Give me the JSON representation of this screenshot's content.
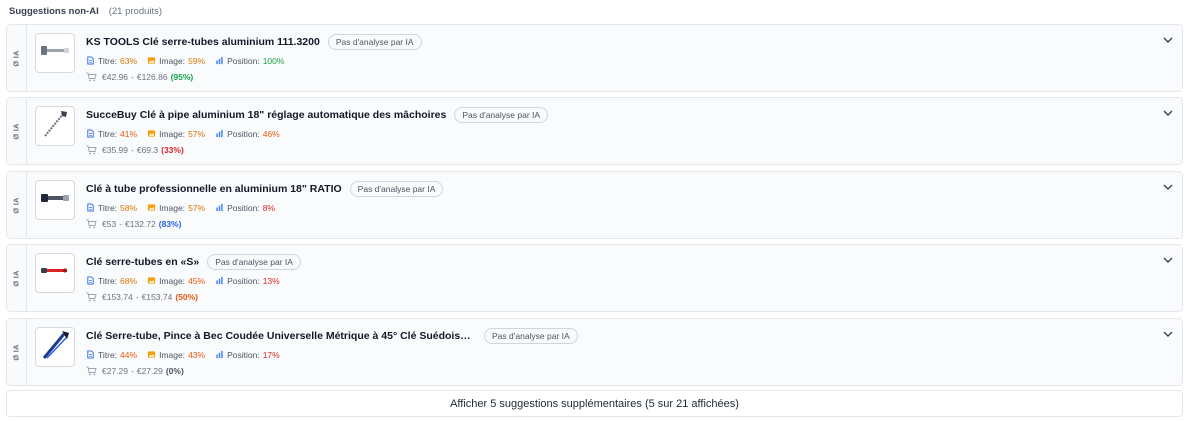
{
  "header": {
    "title": "Suggestions non-AI",
    "count": "(21 produits)"
  },
  "rail_label": "Ø IA",
  "labels": {
    "title": "Titre:",
    "image": "Image:",
    "position": "Position:",
    "badge": "Pas d'analyse par IA",
    "price_sep": "-"
  },
  "colors": {
    "green": "#16a34a",
    "amber": "#d97706",
    "orange": "#ea580c",
    "red": "#dc2626",
    "blue": "#2563eb",
    "gray": "#4b5563"
  },
  "products": [
    {
      "name": "KS TOOLS Clé serre-tubes aluminium 111.3200",
      "title": "63%",
      "image": "59%",
      "position": "100%",
      "price_min": "€42.96",
      "price_max": "€126.86",
      "pct": "(95%)",
      "thumb": "pipe-wrench-silver-icon"
    },
    {
      "name": "SuccеBuy Clé à pipe aluminium 18\" réglage automatique des mâchoires",
      "title": "41%",
      "image": "57%",
      "position": "46%",
      "price_min": "€35.99",
      "price_max": "€69.3",
      "pct": "(33%)",
      "thumb": "pipe-wrench-diagonal-icon"
    },
    {
      "name": "Clé à tube professionnelle en aluminium 18\" RATIO",
      "title": "58%",
      "image": "57%",
      "position": "8%",
      "price_min": "€53",
      "price_max": "€132.72",
      "pct": "(83%)",
      "thumb": "pipe-wrench-dark-icon"
    },
    {
      "name": "Clé serre-tubes en «S»",
      "title": "68%",
      "image": "45%",
      "position": "13%",
      "price_min": "€153.74",
      "price_max": "€153.74",
      "pct": "(50%)",
      "thumb": "pipe-wrench-red-icon"
    },
    {
      "name": "Clé Serre-tube, Pince à Bec Coudée Universelle Métrique à 45° Clé Suédoise en ...",
      "title": "44%",
      "image": "43%",
      "position": "17%",
      "price_min": "€27.29",
      "price_max": "€27.29",
      "pct": "(0%)",
      "thumb": "pipe-wrench-blue-icon"
    }
  ],
  "more_button": "Afficher 5 suggestions supplémentaires (5 sur 21 affichées)"
}
